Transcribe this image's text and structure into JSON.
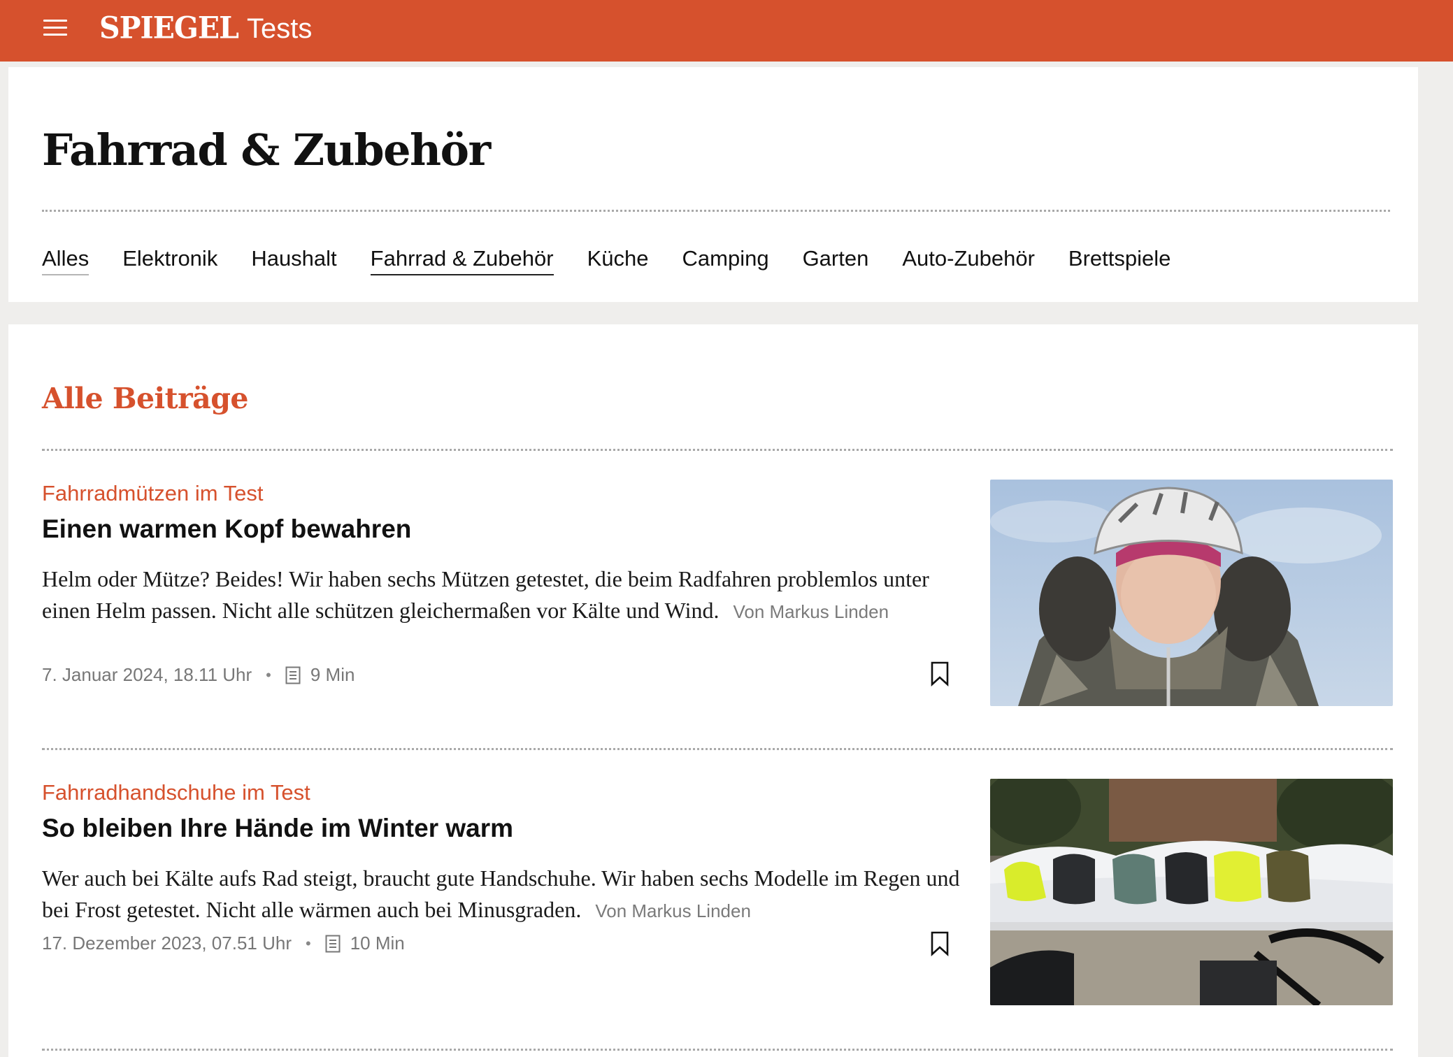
{
  "header": {
    "logo_main": "SPIEGEL",
    "logo_sub": "Tests",
    "menu_icon": "hamburger-menu-icon",
    "brand_color": "#d6512d"
  },
  "page": {
    "title": "Fahrrad & Zubehör",
    "nav": [
      {
        "label": "Alles"
      },
      {
        "label": "Elektronik"
      },
      {
        "label": "Haushalt"
      },
      {
        "label": "Fahrrad & Zubehör",
        "active": true
      },
      {
        "label": "Küche"
      },
      {
        "label": "Camping"
      },
      {
        "label": "Garten"
      },
      {
        "label": "Auto-Zubehör"
      },
      {
        "label": "Brettspiele"
      }
    ]
  },
  "feed": {
    "section_title": "Alle Beiträge",
    "articles": [
      {
        "kicker": "Fahrradmützen im Test",
        "headline": "Einen warmen Kopf bewahren",
        "teaser": "Helm oder Mütze? Beides! Wir haben sechs Mützen getestet, die beim Radfahren problemlos unter einen Helm passen. Nicht alle schützen gleichermaßen vor Kälte und Wind.",
        "author": "Von Markus Linden",
        "date": "7. Januar 2024, 18.11 Uhr",
        "read_time": "9 Min",
        "image_icon": "cyclist-winter-helmet-photo",
        "bookmark_icon": "bookmark-icon"
      },
      {
        "kicker": "Fahrradhandschuhe im Test",
        "headline": "So bleiben Ihre Hände im Winter warm",
        "teaser": "Wer auch bei Kälte aufs Rad steigt, braucht gute Handschuhe. Wir haben sechs Modelle im Regen und bei Frost getestet. Nicht alle wärmen auch bei Minusgraden.",
        "author": "Von Markus Linden",
        "date": "17. Dezember 2023, 07.51 Uhr",
        "read_time": "10 Min",
        "image_icon": "winter-gloves-snow-photo",
        "bookmark_icon": "bookmark-icon"
      }
    ]
  }
}
